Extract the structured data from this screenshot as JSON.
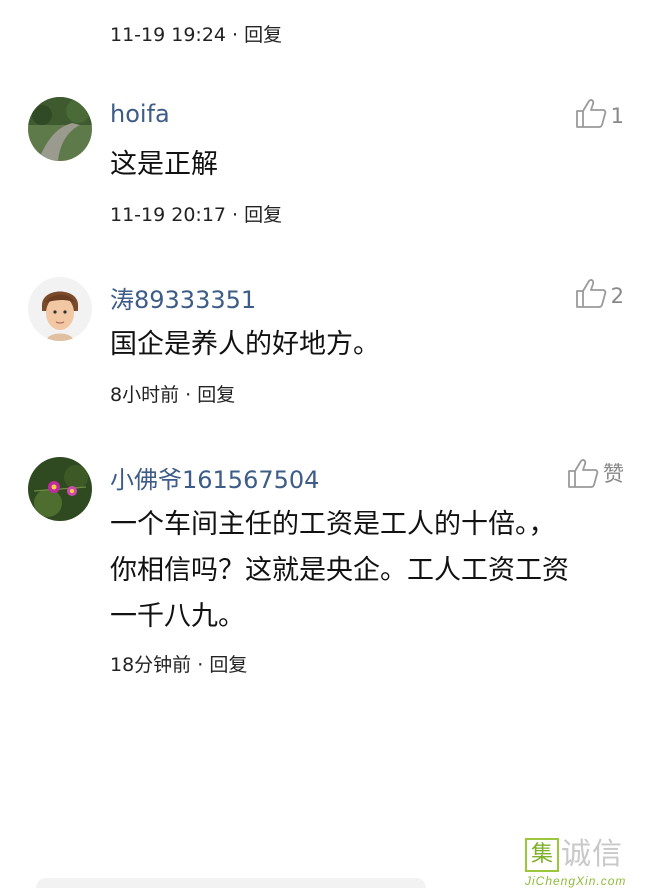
{
  "top_meta": {
    "time": "11-19 19:24",
    "separator": " · ",
    "reply": "回复"
  },
  "comments": [
    {
      "username": "hoifa",
      "content": "这是正解",
      "time": "11-19 20:17",
      "separator": " · ",
      "reply": "回复",
      "likes": "1"
    },
    {
      "username": "涛89333351",
      "content": "国企是养人的好地方。",
      "time": "8小时前",
      "separator": " · ",
      "reply": "回复",
      "likes": "2"
    },
    {
      "username": "小佛爷161567504",
      "content_lines": [
        "一个车间主任的工资是工人的十倍。，",
        "你相信吗？这就是央企。工人工资工资",
        "一千八九。"
      ],
      "time": "18分钟前",
      "separator": " · ",
      "reply": "回复",
      "likes": "赞"
    }
  ],
  "watermark": {
    "box_char": "集",
    "chars": "诚信",
    "url": "JiChengXin.com"
  },
  "colors": {
    "username": "#3d5c87",
    "like_icon": "#9a9a9a",
    "watermark_green": "#8fbc3a"
  }
}
